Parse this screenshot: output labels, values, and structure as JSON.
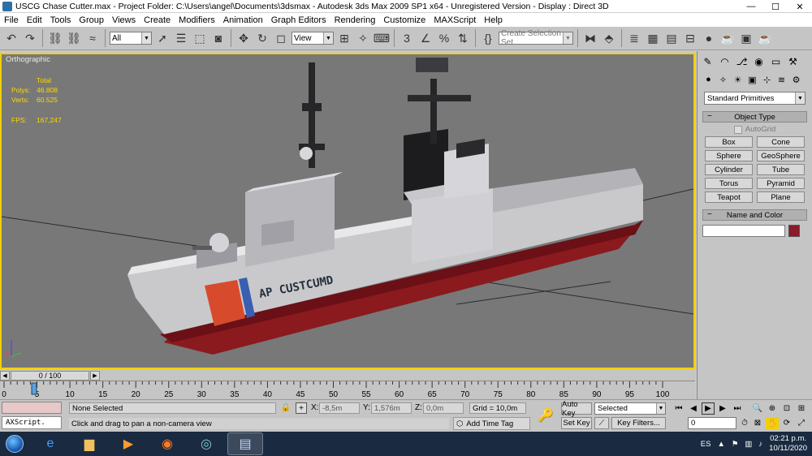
{
  "titlebar": {
    "title": "USCG Chase Cutter.max     - Project Folder: C:\\Users\\angel\\Documents\\3dsmax     - Autodesk 3ds Max  2009 SP1  x64   - Unregistered Version     - Display : Direct 3D",
    "minimize": "—",
    "maximize": "☐",
    "close": "✕"
  },
  "menu": [
    "File",
    "Edit",
    "Tools",
    "Group",
    "Views",
    "Create",
    "Modifiers",
    "Animation",
    "Graph Editors",
    "Rendering",
    "Customize",
    "MAXScript",
    "Help"
  ],
  "toolbar": {
    "selection_filter": "All",
    "ref_coord": "View",
    "named_selection_placeholder": "Create Selection Set"
  },
  "viewport": {
    "label": "Orthographic",
    "stats": {
      "header": "Total",
      "polys_label": "Polys:",
      "polys_value": "46.808",
      "verts_label": "Verts:",
      "verts_value": "60.525",
      "fps_label": "FPS:",
      "fps_value": "167,247"
    },
    "hull_text": "AP CUSTCUMD",
    "colors": {
      "hull": "#c9c9cc",
      "waterline": "#8a1a1e",
      "background": "#787878",
      "border": "#f0d000",
      "stats": "#ffd800"
    }
  },
  "command_panel": {
    "category": "Standard Primitives",
    "object_type_title": "Object Type",
    "autogrid_label": "AutoGrid",
    "objects": [
      "Box",
      "Cone",
      "Sphere",
      "GeoSphere",
      "Cylinder",
      "Tube",
      "Torus",
      "Pyramid",
      "Teapot",
      "Plane"
    ],
    "name_color_title": "Name and Color",
    "object_color": "#8b1a2a"
  },
  "timeline": {
    "slider_label": "0 / 100",
    "ticks": [
      "0",
      "5",
      "10",
      "15",
      "20",
      "25",
      "30",
      "35",
      "40",
      "45",
      "50",
      "55",
      "60",
      "65",
      "70",
      "75",
      "80",
      "85",
      "90",
      "95",
      "100"
    ]
  },
  "status": {
    "maxscript": "AXScript.",
    "selection": "None Selected",
    "prompt": "Click and drag to pan a non-camera view",
    "x_label": "X:",
    "x_value": "-8,5m",
    "y_label": "Y:",
    "y_value": "1,576m",
    "z_label": "Z:",
    "z_value": "0,0m",
    "grid": "Grid = 10,0m",
    "add_time_tag": "Add Time Tag",
    "auto_key": "Auto Key",
    "set_key": "Set Key",
    "selected": "Selected",
    "key_filters": "Key Filters...",
    "frame": "0"
  },
  "taskbar": {
    "language": "ES",
    "time": "02:21 p.m.",
    "date": "10/11/2020"
  }
}
